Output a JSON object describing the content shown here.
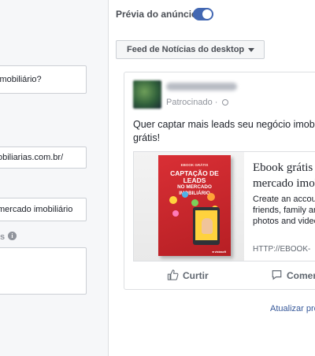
{
  "left_panel": {
    "fields": [
      {
        "name": "headline-field",
        "value": "imobiliário?"
      },
      {
        "name": "website-url-field",
        "value": "obiliarias.com.br/"
      },
      {
        "name": "link-description-field",
        "value": "mercado imobiliário"
      },
      {
        "name": "text-area-field",
        "value": ""
      }
    ],
    "label_fragment": "s"
  },
  "preview": {
    "title": "Prévia do anúncio",
    "toggle_on": true,
    "placement_label": "Feed de Notícias do desktop",
    "accent_color": "#4267b2"
  },
  "post": {
    "sponsored_label": "Patrocinado ·",
    "text": "Quer captar mais leads seu negócio imobi grátis!",
    "link_title_line1": "Ebook grátis",
    "link_title_line2": "mercado imob",
    "link_desc_lines": [
      "Create an account",
      "friends, family and",
      "photos and videos"
    ],
    "link_url": "HTTP://EBOOK-",
    "ebook_kicker": "EBOOK GRÁTIS",
    "ebook_title": "CAPTAÇÃO DE LEADS",
    "ebook_subtitle": "NO MERCADO IMOBILIÁRIO",
    "ebook_footer": "■ vistasoft",
    "like_label": "Curtir",
    "comment_label": "Comer"
  },
  "footer": {
    "refresh_link": "Atualizar pré"
  }
}
